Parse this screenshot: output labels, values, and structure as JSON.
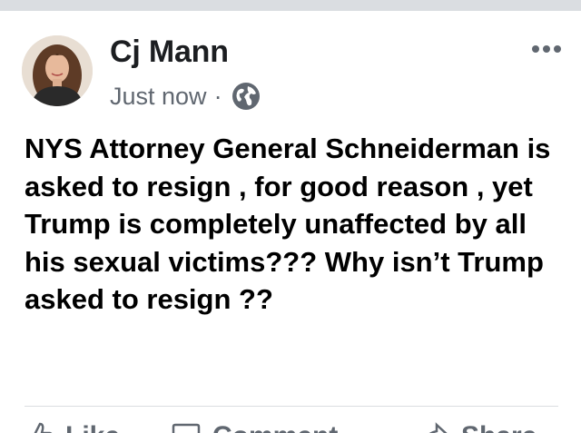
{
  "post": {
    "author": "Cj Mann",
    "timestamp": "Just now",
    "separator": "·",
    "privacy_icon": "globe-icon",
    "more_icon": "more-options-icon",
    "text": "NYS Attorney General Schneiderman is asked to resign , for good reason , yet Trump is completely unaffected by all his sexual victims??? Why isn’t Trump asked to resign ??"
  },
  "actions": [
    {
      "label": "Like",
      "icon": "like-thumb-icon"
    },
    {
      "label": "Comment",
      "icon": "comment-bubble-icon"
    },
    {
      "label": "Share",
      "icon": "share-arrow-icon"
    }
  ],
  "colors": {
    "secondary_text": "#606770",
    "divider": "#dadde1",
    "primary_text": "#000000"
  }
}
